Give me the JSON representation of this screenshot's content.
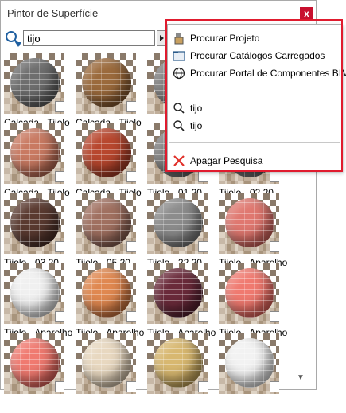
{
  "window": {
    "title": "Pintor de Superfície",
    "close_label": "x"
  },
  "search": {
    "value": "tijo"
  },
  "tiles": [
    {
      "label": "Calçada - Tijolo",
      "color": "#6e6e6e",
      "dark": "#4c4c4c"
    },
    {
      "label": "Calçada - Tijolo",
      "color": "#9b6a3c",
      "dark": "#6a4524"
    },
    {
      "label": "",
      "color": "#7f7f7f",
      "dark": "#555"
    },
    {
      "label": "",
      "color": "#7f7f7f",
      "dark": "#555"
    },
    {
      "label": "Calçada - Tijolo",
      "color": "#c97a62",
      "dark": "#9a5540"
    },
    {
      "label": "Calçada - Tijolo",
      "color": "#b8472e",
      "dark": "#8a2f1c"
    },
    {
      "label": "Tijolo - 01 20",
      "color": "#7f7f7f",
      "dark": "#555"
    },
    {
      "label": "Tijolo - 02 20",
      "color": "#7f7f7f",
      "dark": "#555"
    },
    {
      "label": "Tijolo - 03 20",
      "color": "#5a3a30",
      "dark": "#3a2520"
    },
    {
      "label": "Tijolo - 05 20",
      "color": "#a07060",
      "dark": "#6a4a40"
    },
    {
      "label": "Tijolo - 22 20",
      "color": "#8c8c8c",
      "dark": "#606060"
    },
    {
      "label": "Tijolo - Aparelho",
      "color": "#e07870",
      "dark": "#b04a44"
    },
    {
      "label": "Tijolo - Aparelho",
      "color": "#f0f0f0",
      "dark": "#b9b9b9"
    },
    {
      "label": "Tijolo - Aparelho",
      "color": "#e08850",
      "dark": "#a85a2c"
    },
    {
      "label": "Tijolo - Aparelho",
      "color": "#6a2a3a",
      "dark": "#3e1624"
    },
    {
      "label": "Tijolo - Aparelho",
      "color": "#f07a70",
      "dark": "#c04a44"
    },
    {
      "label": "",
      "color": "#f07a70",
      "dark": "#c04a44"
    },
    {
      "label": "",
      "color": "#e8d8c0",
      "dark": "#b0a08a"
    },
    {
      "label": "",
      "color": "#d8b870",
      "dark": "#a08440"
    },
    {
      "label": "",
      "color": "#f2f2f2",
      "dark": "#bdbdbd"
    }
  ],
  "menu": {
    "items": [
      {
        "label": "Procurar Projeto",
        "icon": "paint-bucket-icon"
      },
      {
        "label": "Procurar Catálogos Carregados",
        "icon": "folder-icon"
      },
      {
        "label": "Procurar Portal de Componentes BIM",
        "icon": "globe-icon"
      },
      {
        "label": "tijo",
        "icon": "magnifier-icon"
      },
      {
        "label": "tijo",
        "icon": "magnifier-icon"
      },
      {
        "label": "Apagar Pesquisa",
        "icon": "red-x-icon"
      }
    ]
  },
  "colors": {
    "highlight": "#e01b2e",
    "close": "#c8102e"
  }
}
